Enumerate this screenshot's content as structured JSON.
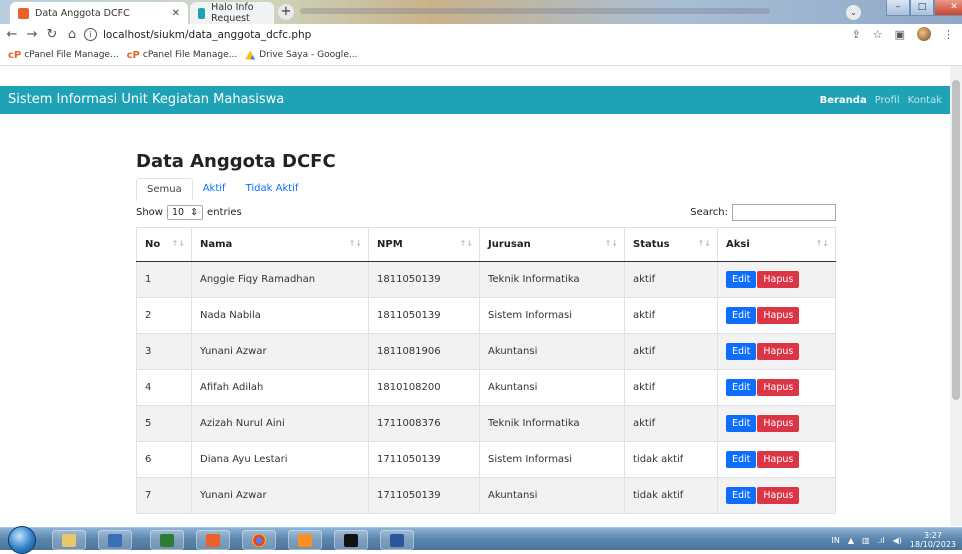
{
  "browser": {
    "tabs": [
      {
        "title": "Data Anggota DCFC",
        "active": true
      },
      {
        "title": "Halo Info Request",
        "active": false
      }
    ],
    "url": "localhost/siukm/data_anggota_dcfc.php",
    "bookmarks": [
      {
        "label": "cPanel File Manage...",
        "icon": "cpanel-icon"
      },
      {
        "label": "cPanel File Manage...",
        "icon": "cpanel-icon"
      },
      {
        "label": "Drive Saya - Google...",
        "icon": "google-drive-icon"
      }
    ]
  },
  "app": {
    "brand": "Sistem Informasi Unit Kegiatan Mahasiswa",
    "nav": [
      "Beranda",
      "Profil",
      "Kontak"
    ]
  },
  "page": {
    "title": "Data Anggota DCFC",
    "tabs": [
      "Semua",
      "Aktif",
      "Tidak Aktif"
    ],
    "show_label": "Show",
    "entries_value": "10",
    "entries_label": "entries",
    "search_label": "Search:",
    "columns": [
      "No",
      "Nama",
      "NPM",
      "Jurusan",
      "Status",
      "Aksi"
    ],
    "edit_label": "Edit",
    "hapus_label": "Hapus",
    "rows": [
      {
        "no": "1",
        "nama": "Anggie Fiqy Ramadhan",
        "npm": "1811050139",
        "jurusan": "Teknik Informatika",
        "status": "aktif"
      },
      {
        "no": "2",
        "nama": "Nada Nabila",
        "npm": "1811050139",
        "jurusan": "Sistem Informasi",
        "status": "aktif"
      },
      {
        "no": "3",
        "nama": "Yunani Azwar",
        "npm": "1811081906",
        "jurusan": "Akuntansi",
        "status": "aktif"
      },
      {
        "no": "4",
        "nama": "Afifah Adilah",
        "npm": "1810108200",
        "jurusan": "Akuntansi",
        "status": "aktif"
      },
      {
        "no": "5",
        "nama": "Azizah Nurul Aini",
        "npm": "1711008376",
        "jurusan": "Teknik Informatika",
        "status": "aktif"
      },
      {
        "no": "6",
        "nama": "Diana Ayu Lestari",
        "npm": "1711050139",
        "jurusan": "Sistem Informasi",
        "status": "tidak aktif"
      },
      {
        "no": "7",
        "nama": "Yunani Azwar",
        "npm": "1711050139",
        "jurusan": "Akuntansi",
        "status": "tidak aktif"
      }
    ]
  },
  "taskbar": {
    "lang": "IN",
    "time": "3:27",
    "date": "18/10/2023"
  },
  "colors": {
    "navbar": "#1fa2b5",
    "edit": "#0d6efd",
    "hapus": "#dc3545",
    "link": "#0d6efd"
  }
}
